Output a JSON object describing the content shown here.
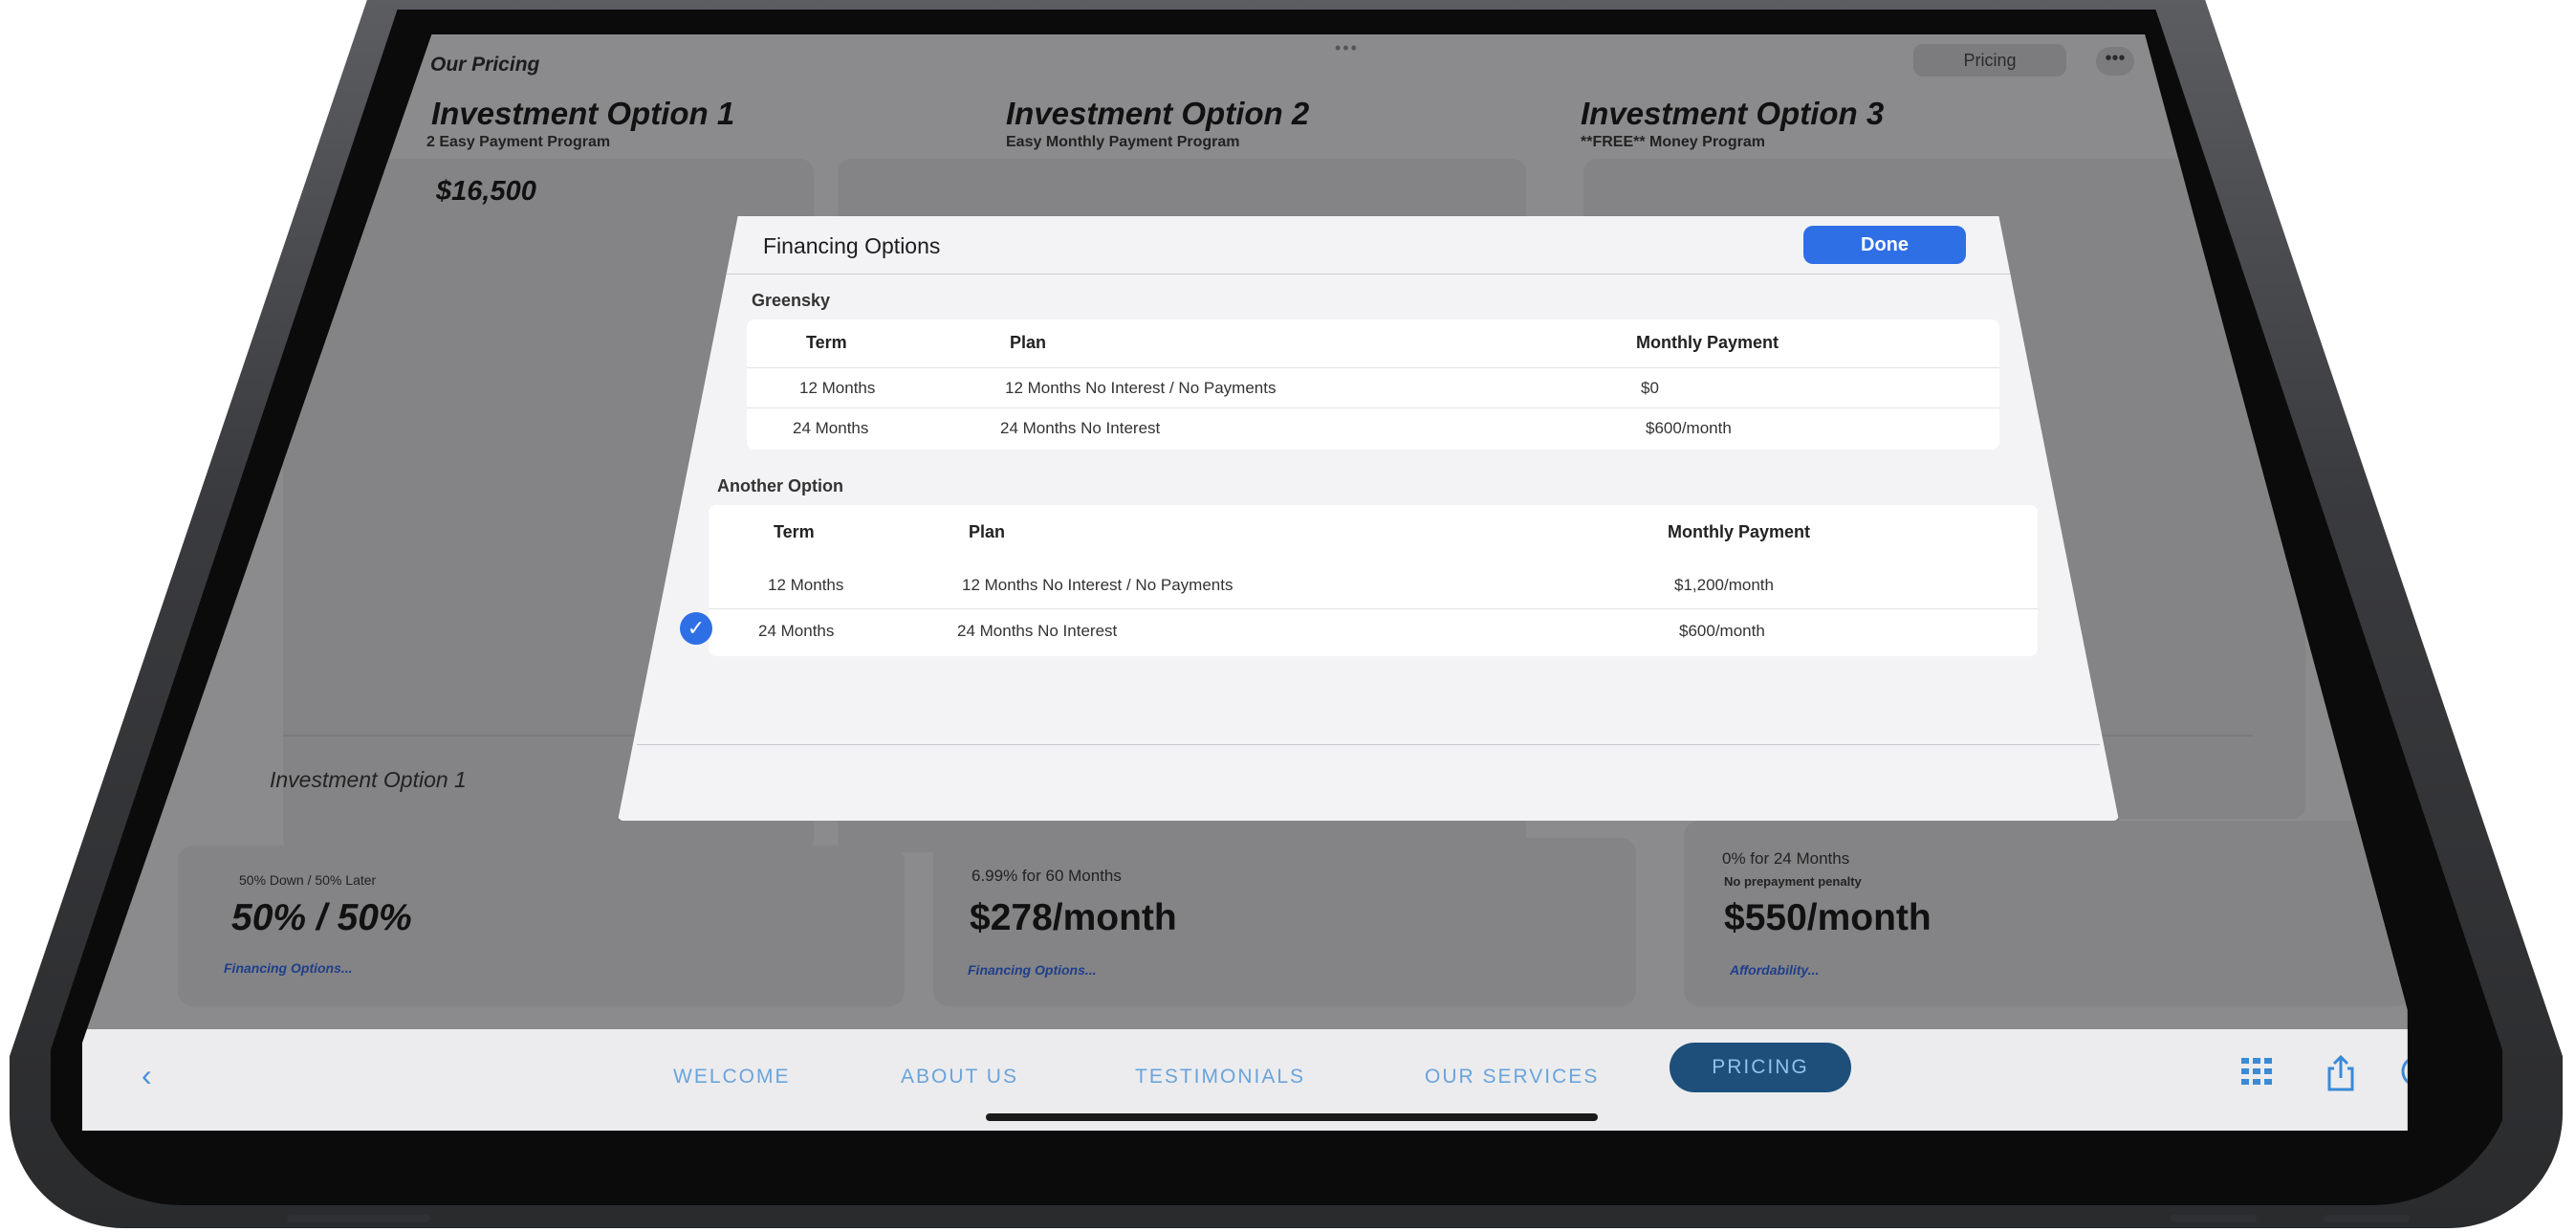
{
  "topbar": {
    "title": "Our Pricing",
    "pricing_button": "Pricing",
    "more_button": "•••",
    "grabber": "•••"
  },
  "columns": [
    {
      "title": "Investment Option 1",
      "subtitle": "2 Easy Payment Program"
    },
    {
      "title": "Investment Option 2",
      "subtitle": "Easy Monthly Payment Program"
    },
    {
      "title": "Investment Option 3",
      "subtitle": "**FREE** Money Program"
    }
  ],
  "card1": {
    "price": "$16,500",
    "footer": "Investment Option 1"
  },
  "bottom_cards": [
    {
      "small": "50% Down / 50% Later",
      "big": "50% / 50%",
      "link": "Financing Options..."
    },
    {
      "small": "6.99% for 60 Months",
      "big": "$278/month",
      "link": "Financing Options..."
    },
    {
      "small": "0% for 24 Months",
      "tiny": "No prepayment penalty",
      "big": "$550/month",
      "link": "Affordability..."
    }
  ],
  "modal": {
    "title": "Financing Options",
    "done_label": "Done",
    "sections": [
      {
        "label": "Greensky",
        "headers": [
          "Term",
          "Plan",
          "Monthly Payment"
        ],
        "rows": [
          {
            "term": "12 Months",
            "plan": "12 Months No Interest / No Payments",
            "payment": "$0"
          },
          {
            "term": "24 Months",
            "plan": "24 Months No Interest",
            "payment": "$600/month"
          }
        ]
      },
      {
        "label": "Another Option",
        "headers": [
          "Term",
          "Plan",
          "Monthly Payment"
        ],
        "rows": [
          {
            "term": "12 Months",
            "plan": "12 Months No Interest / No Payments",
            "payment": "$1,200/month"
          },
          {
            "term": "24 Months",
            "plan": "24 Months No Interest",
            "payment": "$600/month",
            "selected": true
          }
        ]
      }
    ]
  },
  "navbar": {
    "back": "‹",
    "tabs": [
      "WELCOME",
      "ABOUT US",
      "TESTIMONIALS",
      "OUR SERVICES"
    ],
    "active_tab": "PRICING",
    "icons": [
      "grid-icon",
      "share-icon",
      "markup-icon"
    ]
  }
}
